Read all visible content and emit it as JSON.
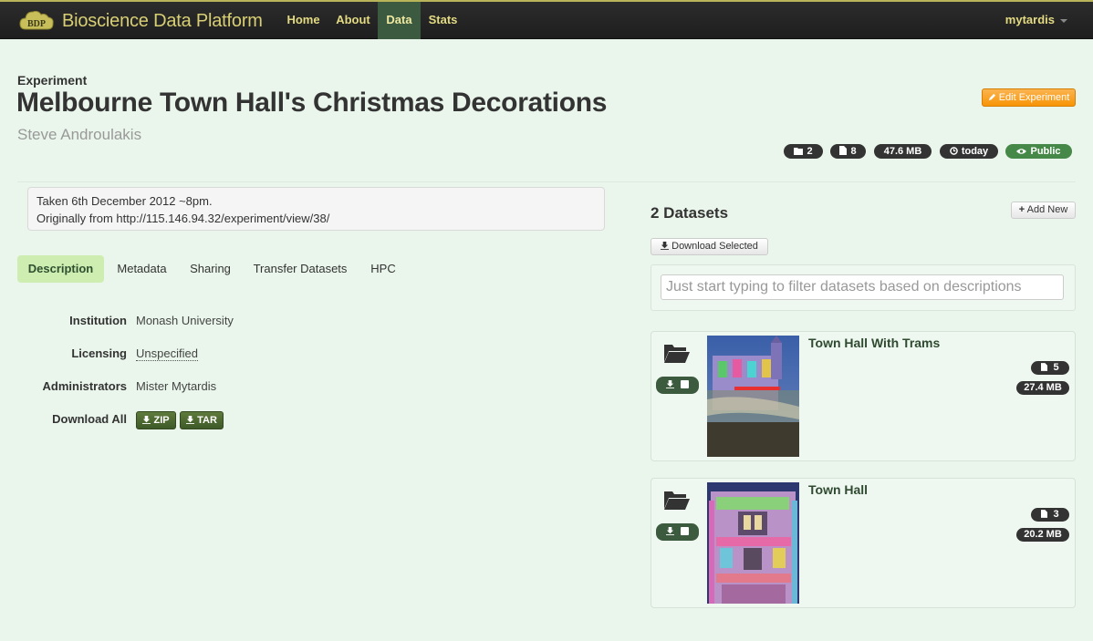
{
  "navbar": {
    "brand_logo_text": "BDP",
    "brand": "Bioscience Data Platform",
    "items": [
      {
        "label": "Home"
      },
      {
        "label": "About"
      },
      {
        "label": "Data"
      },
      {
        "label": "Stats"
      }
    ],
    "active_item": "Data",
    "user": "mytardis"
  },
  "experiment": {
    "label": "Experiment",
    "title": "Melbourne Town Hall's Christmas Decorations",
    "author": "Steve Androulakis",
    "edit_button": "Edit Experiment",
    "badges": {
      "datasets": "2",
      "files": "8",
      "size": "47.6 MB",
      "updated": "today",
      "visibility": "Public"
    },
    "description_lines": [
      "Taken 6th December 2012 ~8pm.",
      "Originally from http://115.146.94.32/experiment/view/38/"
    ]
  },
  "tabs": [
    {
      "label": "Description"
    },
    {
      "label": "Metadata"
    },
    {
      "label": "Sharing"
    },
    {
      "label": "Transfer Datasets"
    },
    {
      "label": "HPC"
    }
  ],
  "active_tab": "Description",
  "details": {
    "institution_label": "Institution",
    "institution": "Monash University",
    "licensing_label": "Licensing",
    "licensing": "Unspecified",
    "administrators_label": "Administrators",
    "administrators": "Mister Mytardis",
    "download_label": "Download All",
    "zip": "ZIP",
    "tar": "TAR"
  },
  "datasets_panel": {
    "heading": "2 Datasets",
    "add_new": "Add New",
    "download_selected": "Download Selected",
    "filter_placeholder": "Just start typing to filter datasets based on descriptions",
    "datasets": [
      {
        "title": "Town Hall With Trams",
        "files": "5",
        "size": "27.4 MB"
      },
      {
        "title": "Town Hall",
        "files": "3",
        "size": "20.2 MB"
      }
    ]
  },
  "colors": {
    "page_bg": "#eaf6ec",
    "navbar_bg": "#222222",
    "brand_text": "#d8cf74",
    "active_tab_bg": "#cdeeb0",
    "edit_button": "#f89406",
    "public_badge": "#468847",
    "download_buttons": "#4a6a30"
  }
}
